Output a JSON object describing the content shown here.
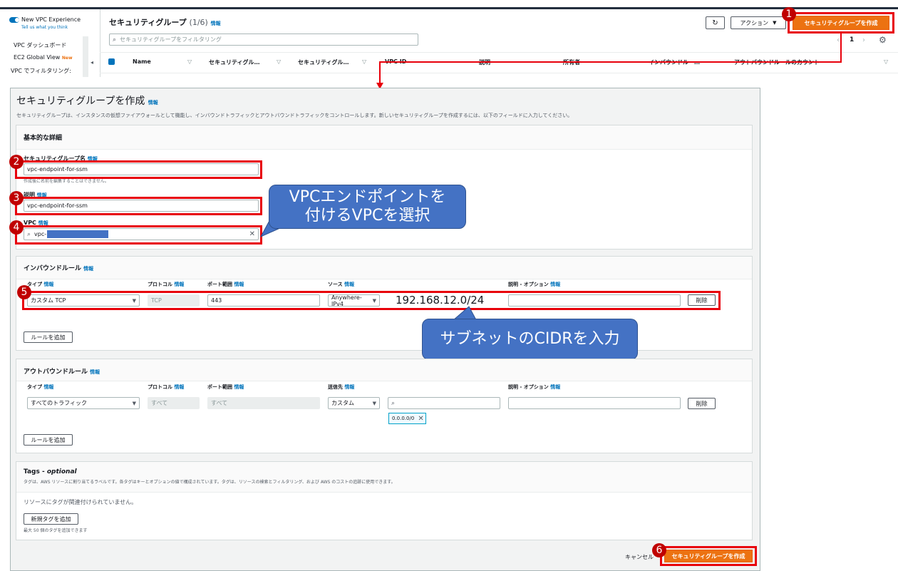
{
  "console": {
    "toggle_label": "New VPC Experience",
    "feedback_link": "Tell us what you think",
    "sidebar_items": [
      "VPC ダッシュボード",
      "EC2 Global View",
      "VPC でフィルタリング:"
    ],
    "new_badge": "New",
    "title": "セキュリティグループ",
    "count": "(1/6)",
    "info": "情報",
    "filter_placeholder": "セキュリティグループをフィルタリング",
    "actions_label": "アクション",
    "create_button": "セキュリティグループを作成",
    "page_num": "1",
    "columns": [
      "Name",
      "セキュリティグル…",
      "セキュリティグル…",
      "VPC ID",
      "説明",
      "所有者",
      "インバウンドルー…",
      "アウトバウンドルールのカウント"
    ]
  },
  "form": {
    "title": "セキュリティグループを作成",
    "info": "情報",
    "description": "セキュリティグループは、インスタンスの仮想ファイアウォールとして機能し、インバウンドトラフィックとアウトバウンドトラフィックをコントロールします。新しいセキュリティグループを作成するには、以下のフィールドに入力してください。",
    "basic": {
      "heading": "基本的な詳細",
      "name_label": "セキュリティグループ名",
      "name_value": "vpc-endpoint-for-ssm",
      "name_hint": "作成後に名前を編集することはできません。",
      "desc_label": "説明",
      "desc_value": "vpc-endpoint-for-ssm",
      "vpc_label": "VPC",
      "vpc_value": "vpc-"
    },
    "inbound": {
      "heading": "インバウンドルール",
      "col_type": "タイプ",
      "col_protocol": "プロトコル",
      "col_port": "ポート範囲",
      "col_source": "ソース",
      "col_desc": "説明 - オプション",
      "type_value": "カスタム TCP",
      "protocol_value": "TCP",
      "port_value": "443",
      "source_value": "Anywhere-IPv4",
      "cidr_value": "192.168.12.0/24",
      "delete": "削除",
      "add_rule": "ルールを追加"
    },
    "outbound": {
      "heading": "アウトバウンドルール",
      "col_type": "タイプ",
      "col_protocol": "プロトコル",
      "col_port": "ポート範囲",
      "col_dest": "送信先",
      "col_desc": "説明 - オプション",
      "type_value": "すべてのトラフィック",
      "protocol_value": "すべて",
      "port_value": "すべて",
      "dest_value": "カスタム",
      "cidr_token": "0.0.0.0/0",
      "delete": "削除",
      "add_rule": "ルールを追加"
    },
    "tags": {
      "heading_prefix": "Tags - ",
      "heading_optional": "optional",
      "description": "タグは、AWS リソースに割り当てるラベルです。各タグはキーとオプションの値で構成されています。タグは、リソースの検索とフィルタリング、および AWS のコストの追跡に使用できます。",
      "empty": "リソースにタグが関連付けられていません。",
      "add_tag": "新規タグを追加",
      "limit": "最大 50 個のタグを追加できます"
    },
    "cancel": "キャンセル",
    "submit": "セキュリティグループを作成"
  },
  "annotations": {
    "badges": [
      "1",
      "2",
      "3",
      "4",
      "5",
      "6"
    ],
    "callout_vpc_line1": "VPCエンドポイントを",
    "callout_vpc_line2": "付けるVPCを選択",
    "callout_cidr": "サブネットのCIDRを入力"
  },
  "colors": {
    "primary_orange": "#ec7211",
    "link_blue": "#0073bb",
    "annotation_red": "#e8000b",
    "callout_blue": "#4472c4"
  }
}
